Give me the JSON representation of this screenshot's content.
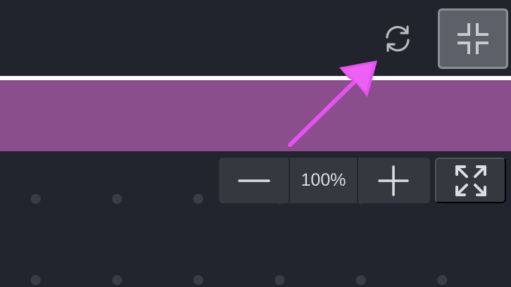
{
  "colors": {
    "background": "#22252e",
    "top_bar": "#21242c",
    "divider": "#ffffff",
    "band": "#8a4e8c",
    "button_bg": "#363840",
    "active_button_bg": "#5d6068",
    "icon": "#dcdde0",
    "annotation": "#e651f0"
  },
  "toolbar": {
    "sync_icon": "sync-icon",
    "collapse_icon": "collapse-icon"
  },
  "zoom": {
    "zoom_out_icon": "minus-icon",
    "level": "100%",
    "zoom_in_icon": "plus-icon",
    "fullscreen_icon": "expand-icon"
  }
}
